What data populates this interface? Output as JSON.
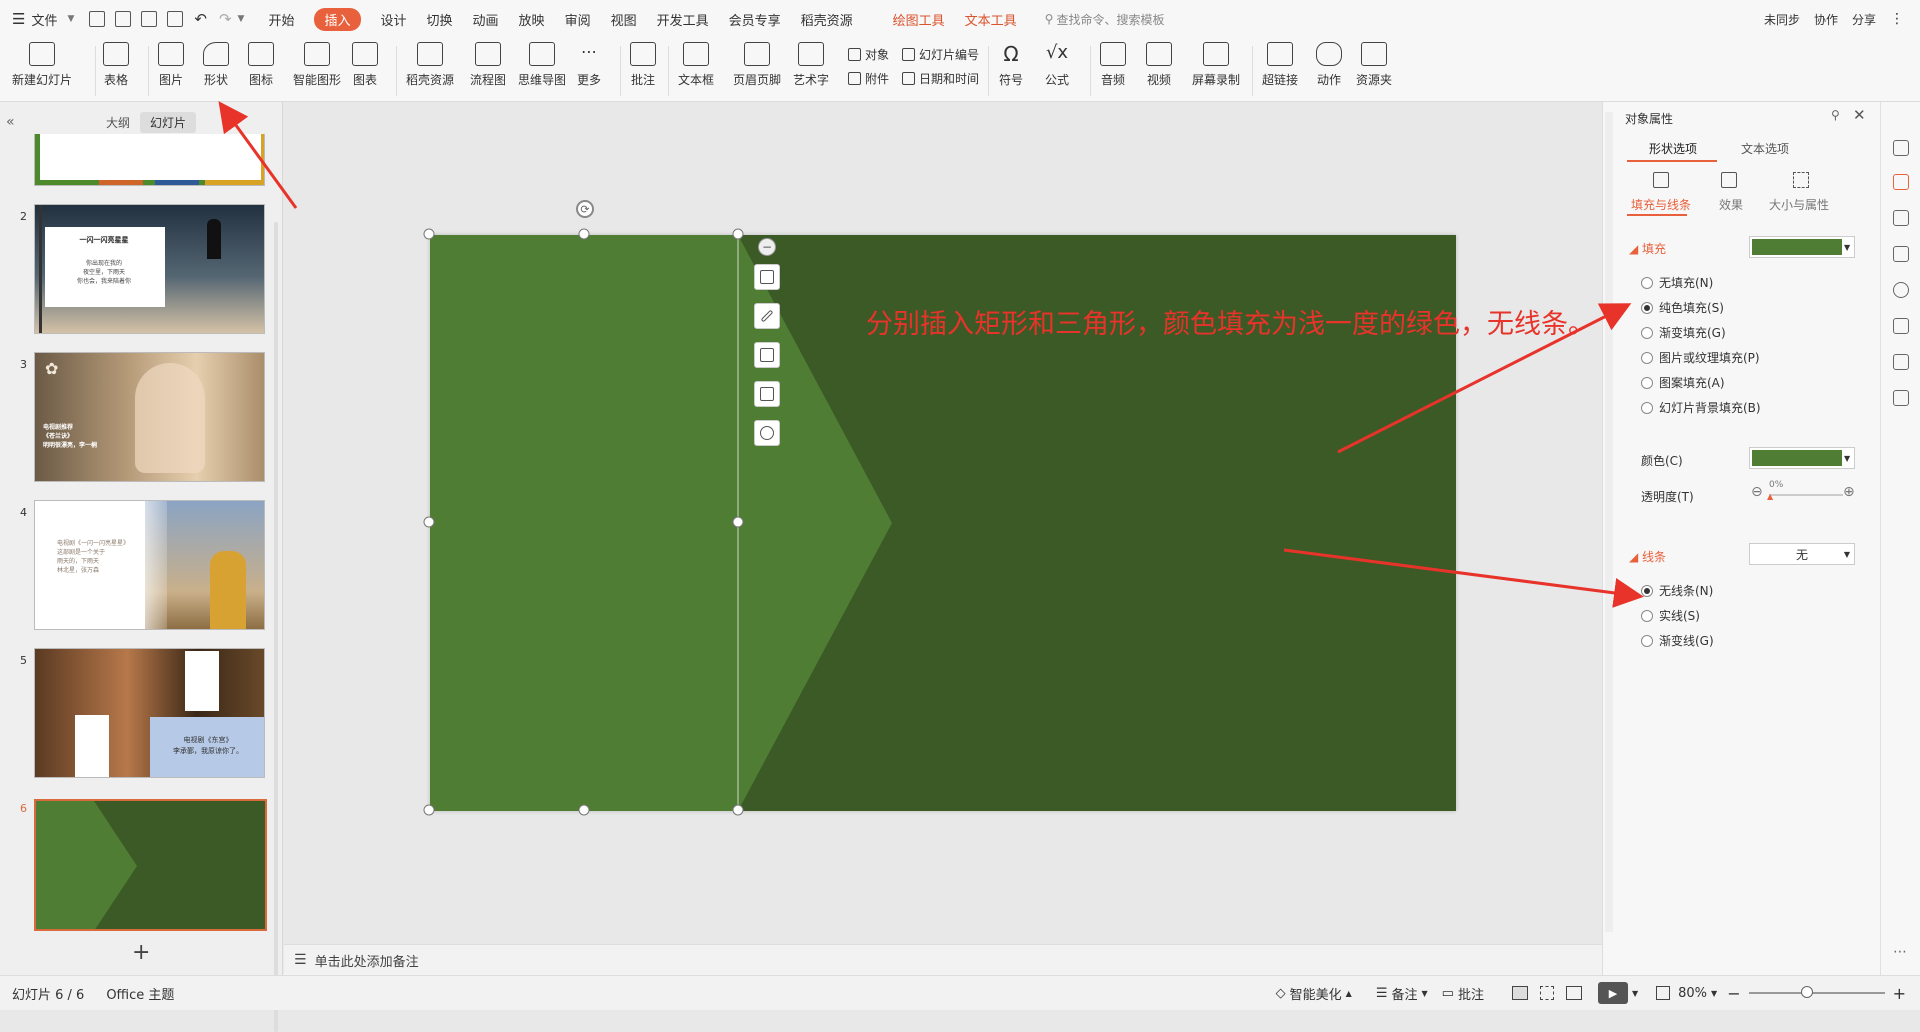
{
  "menubar": {
    "file_label": "文件",
    "tabs": [
      "开始",
      "插入",
      "设计",
      "切换",
      "动画",
      "放映",
      "审阅",
      "视图",
      "开发工具",
      "会员专享",
      "稻壳资源"
    ],
    "active_tab": "插入",
    "context_tabs": [
      "绘图工具",
      "文本工具"
    ],
    "search_placeholder": "查找命令、搜索模板",
    "right": {
      "sync": "未同步",
      "collab": "协作",
      "share": "分享"
    }
  },
  "ribbon": {
    "buttons": [
      "新建幻灯片",
      "表格",
      "图片",
      "形状",
      "图标",
      "智能图形",
      "图表",
      "稻壳资源",
      "流程图",
      "思维导图",
      "更多",
      "批注",
      "文本框",
      "页眉页脚",
      "艺术字",
      "符号",
      "公式",
      "音频",
      "视频",
      "屏幕录制",
      "超链接",
      "动作",
      "资源夹"
    ],
    "small": {
      "object": "对象",
      "slide_number": "幻灯片编号",
      "attachment": "附件",
      "datetime": "日期和时间"
    }
  },
  "left_panel": {
    "tabs": [
      "大纲",
      "幻灯片"
    ],
    "selected_tab": "幻灯片",
    "slides": [
      {
        "num": "2",
        "title": "一闪一闪亮星星",
        "lines": [
          "你出现在我的",
          "夜空里，下雨天",
          "你也会，我来陪着你"
        ]
      },
      {
        "num": "3",
        "title": "电视剧推荐",
        "lines": [
          "《苍兰诀》",
          "明明很漂亮，李一桐"
        ]
      },
      {
        "num": "4",
        "title": "电视剧《一闪一闪亮星星》",
        "lines": [
          "这部剧是一个关于",
          "雨天的，下雨天",
          "林北星，张万森"
        ]
      },
      {
        "num": "5",
        "title": "电视剧《东宫》",
        "lines": [
          "李承鄞，我原谅你了。"
        ]
      },
      {
        "num": "6"
      }
    ],
    "add_label": "+"
  },
  "annotation": "分别插入矩形和三角形，颜色填充为浅一度的绿色，无线条。",
  "notes_placeholder": "单击此处添加备注",
  "right_pane": {
    "title": "对象属性",
    "tabs": [
      "形状选项",
      "文本选项"
    ],
    "subtabs": [
      "填充与线条",
      "效果",
      "大小与属性"
    ],
    "fill_section": "填充",
    "fill_options": [
      "无填充(N)",
      "纯色填充(S)",
      "渐变填充(G)",
      "图片或纹理填充(P)",
      "图案填充(A)",
      "幻灯片背景填充(B)"
    ],
    "fill_selected": "纯色填充(S)",
    "color_label": "颜色(C)",
    "transparency_label": "透明度(T)",
    "transparency_value": "0%",
    "line_section": "线条",
    "line_value": "无",
    "line_options": [
      "无线条(N)",
      "实线(S)",
      "渐变线(G)"
    ],
    "line_selected": "无线条(N)",
    "fill_color": "#4f7d34"
  },
  "statusbar": {
    "slide_counter": "幻灯片 6 / 6",
    "theme": "Office 主题",
    "beautify": "智能美化",
    "notes": "备注",
    "comments": "批注",
    "zoom": "80%"
  },
  "colors": {
    "slide_bg": "#3b5a26",
    "shape_fill": "#4f7d34",
    "accent": "#e8613c",
    "annotation": "#e8332a"
  }
}
